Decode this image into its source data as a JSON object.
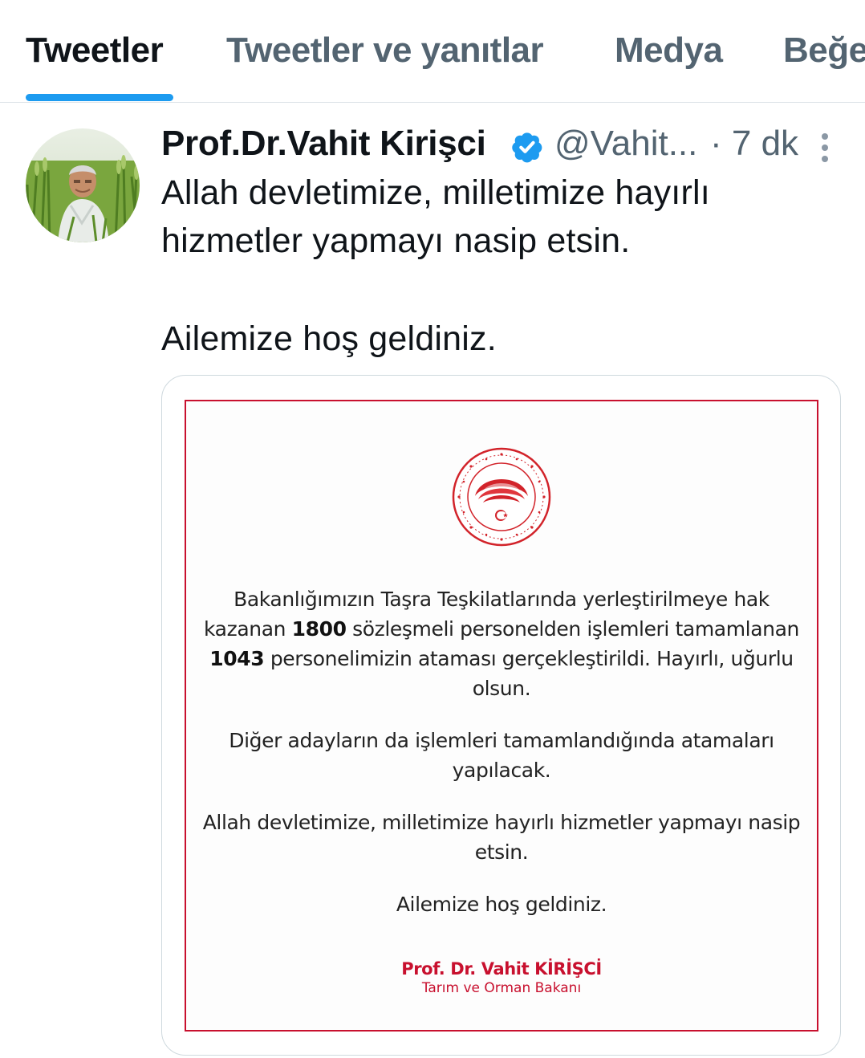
{
  "tabs": {
    "items": [
      {
        "label": "Tweetler",
        "active": true
      },
      {
        "label": "Tweetler ve yanıtlar",
        "active": false
      },
      {
        "label": "Medya",
        "active": false
      },
      {
        "label": "Beğe",
        "active": false
      }
    ],
    "accent_color": "#1d9bf0"
  },
  "tweet": {
    "author": {
      "display_name": "Prof.Dr.Vahit Kirişci",
      "handle": "@Vahit...",
      "verified": true,
      "avatar_icon": "avatar-photo"
    },
    "time": "· 7 dk",
    "more_icon": "more-vertical-icon",
    "text_lines": [
      "Allah devletimize, milletimize hayırlı hizmetler yapmayı nasip etsin.",
      "Ailemize hoş geldiniz."
    ],
    "media": {
      "frame_color": "#c8102e",
      "emblem_icon": "ministry-emblem-icon",
      "paragraph1": {
        "part1": "Bakanlığımızın Taşra Teşkilatlarında yerleştirilmeye hak kazanan ",
        "num1": "1800",
        "part2": " sözleşmeli personelden işlemleri tamamlanan ",
        "num2": "1043",
        "part3": " personelimizin ataması gerçekleştirildi. Hayırlı, uğurlu olsun."
      },
      "paragraph2": "Diğer adayların da işlemleri tamamlandığında atamaları yapılacak.",
      "paragraph3": "Allah devletimize, milletimize hayırlı hizmetler yapmayı nasip etsin.",
      "paragraph4": "Ailemize hoş geldiniz.",
      "signature_name": "Prof. Dr. Vahit KİRİŞCİ",
      "signature_title": "Tarım ve Orman Bakanı"
    }
  }
}
